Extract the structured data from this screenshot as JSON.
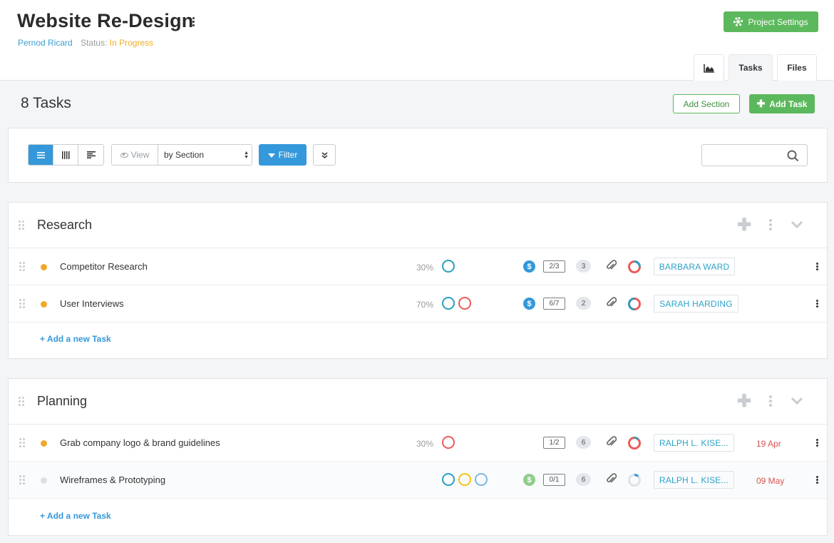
{
  "project": {
    "title": "Website Re-Design",
    "client": "Pernod Ricard",
    "status_label": "Status:",
    "status_value": "In Progress",
    "settings_label": "Project Settings"
  },
  "tabs": {
    "tasks": "Tasks",
    "files": "Files",
    "chart_icon": "area-chart-icon"
  },
  "task_count": "8 Tasks",
  "actions": {
    "add_section": "Add Section",
    "add_task": "Add Task"
  },
  "toolbar": {
    "view_label": "View",
    "group_by": "by Section",
    "filter_label": "Filter",
    "search_placeholder": ""
  },
  "colors": {
    "primary": "#3498db",
    "green": "#5cb85c",
    "orange": "#f0a728",
    "teal": "#2a9fc0",
    "red": "#ea5b58",
    "yellow": "#f2c51b",
    "light_blue": "#79b8e6",
    "muted_green": "#8fce8a"
  },
  "sections": [
    {
      "title": "Research",
      "add_new": "+ Add a new Task",
      "tasks": [
        {
          "name": "Competitor Research",
          "progress": "30%",
          "subtasks": "2/3",
          "comments": "3",
          "assignee": "BARBARA WARD",
          "due": ""
        },
        {
          "name": "User Interviews",
          "progress": "70%",
          "subtasks": "6/7",
          "comments": "2",
          "assignee": "SARAH HARDING",
          "due": ""
        }
      ]
    },
    {
      "title": "Planning",
      "add_new": "+ Add a new Task",
      "tasks": [
        {
          "name": "Grab company logo & brand guidelines",
          "progress": "30%",
          "subtasks": "1/2",
          "comments": "6",
          "assignee": "RALPH L. KISE...",
          "due": "19 Apr"
        },
        {
          "name": "Wireframes & Prototyping",
          "progress": "",
          "subtasks": "0/1",
          "comments": "6",
          "assignee": "RALPH L. KISE...",
          "due": "09 May"
        }
      ]
    }
  ]
}
